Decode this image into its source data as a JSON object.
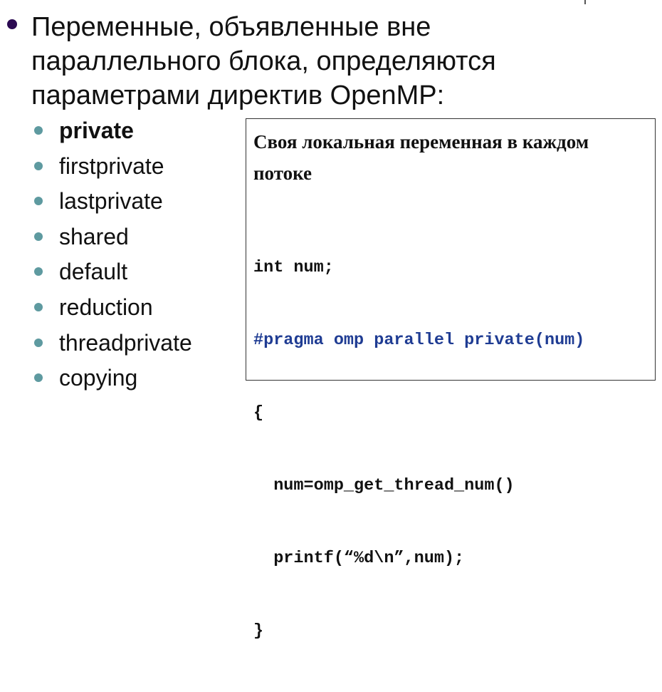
{
  "slide": {
    "heading": "Переменные, объявленные вне параллельного блока, определяются параметрами директив OpenMP:",
    "options": [
      {
        "label": "private",
        "bold": true
      },
      {
        "label": "firstprivate",
        "bold": false
      },
      {
        "label": "lastprivate",
        "bold": false
      },
      {
        "label": "shared",
        "bold": false
      },
      {
        "label": "default",
        "bold": false
      },
      {
        "label": "reduction",
        "bold": false
      },
      {
        "label": "threadprivate",
        "bold": false
      },
      {
        "label": "copying",
        "bold": false
      }
    ]
  },
  "code_box": {
    "title": "Своя локальная переменная в каждом потоке",
    "lines": [
      {
        "text": "int num;",
        "kind": "plain"
      },
      {
        "text": "#pragma omp parallel private(num)",
        "kind": "directive"
      },
      {
        "text": "{",
        "kind": "plain"
      },
      {
        "text": "  num=omp_get_thread_num()",
        "kind": "plain"
      },
      {
        "text": "  printf(“%d\\n”,num);",
        "kind": "plain"
      },
      {
        "text": "}",
        "kind": "plain"
      }
    ]
  },
  "colors": {
    "main_bullet": "#2b0a52",
    "sub_bullet": "#5e9aa0",
    "directive_text": "#1f3c93",
    "text": "#111111"
  }
}
